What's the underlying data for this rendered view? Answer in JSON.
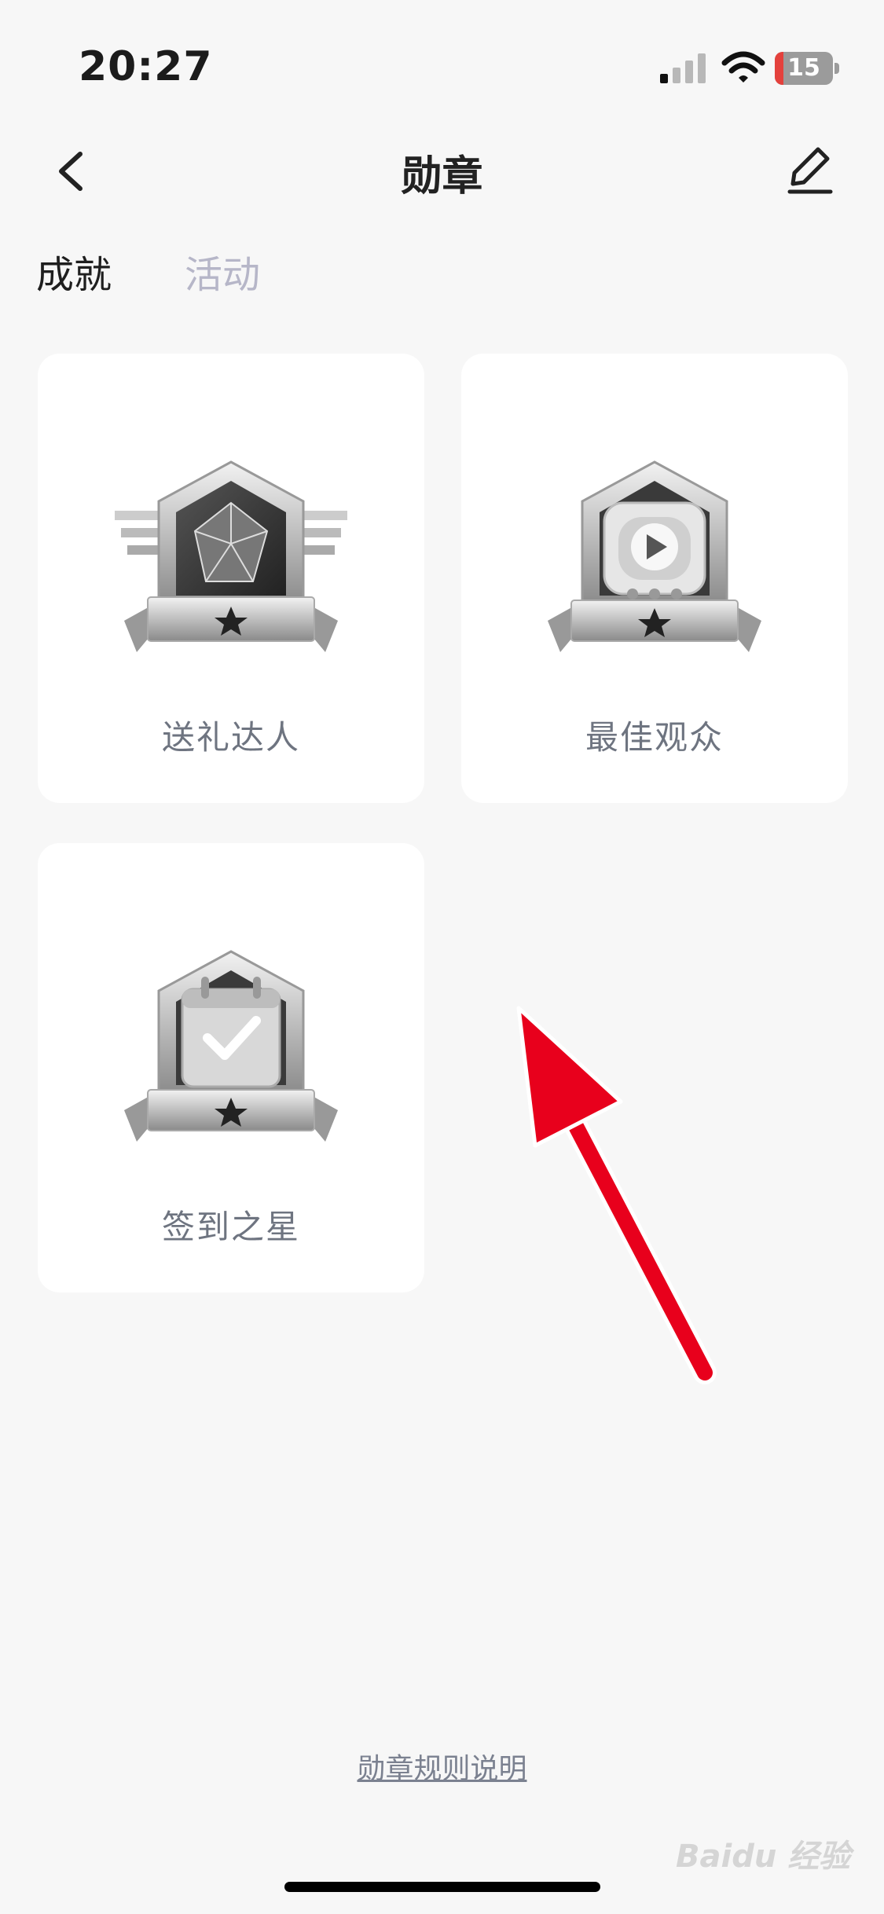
{
  "status_bar": {
    "time": "20:27",
    "battery_level": "15",
    "battery_fraction": 0.15,
    "signal_icon": "cellular-signal-icon",
    "wifi_icon": "wifi-icon"
  },
  "nav": {
    "title": "勋章",
    "back_icon": "chevron-left-icon",
    "edit_icon": "pencil-edit-icon"
  },
  "tabs": [
    {
      "label": "成就",
      "active": true
    },
    {
      "label": "活动",
      "active": false
    }
  ],
  "badges": [
    {
      "name": "送礼达人",
      "icon": "gift-diamond-badge-icon"
    },
    {
      "name": "最佳观众",
      "icon": "tv-play-badge-icon"
    },
    {
      "name": "签到之星",
      "icon": "calendar-check-badge-icon"
    }
  ],
  "footer": {
    "rules_link": "勋章规则说明"
  },
  "watermark": {
    "text": "Baidu 经验"
  },
  "colors": {
    "background": "#f7f7f7",
    "card": "#ffffff",
    "annotation_arrow": "#e8001c",
    "inactive_tab": "#b6b6c8",
    "battery_low": "#e4413c"
  }
}
